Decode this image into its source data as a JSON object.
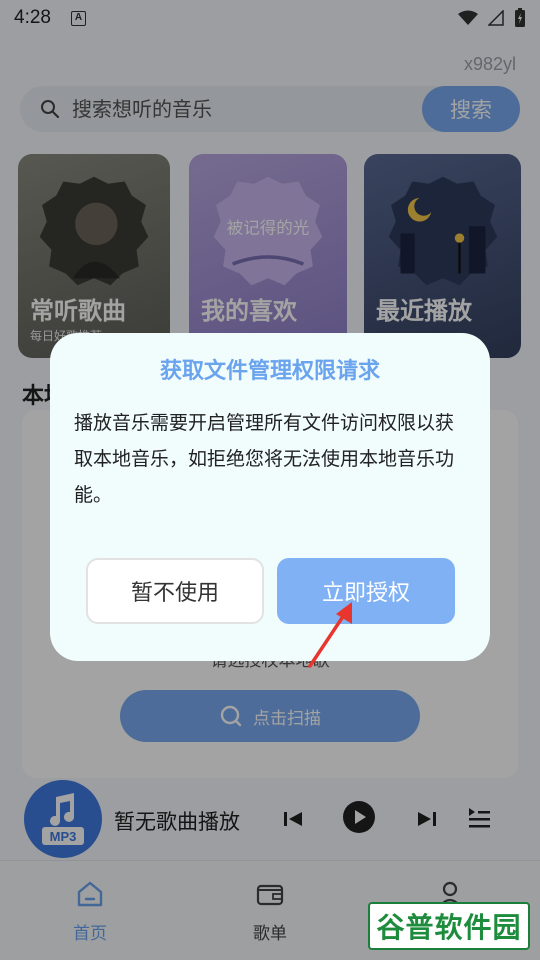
{
  "status_bar": {
    "time": "4:28",
    "a_icon": "A"
  },
  "user": {
    "id": "x982yl"
  },
  "search": {
    "placeholder": "搜索想听的音乐",
    "button_label": "搜索"
  },
  "cards": [
    {
      "title": "常听歌曲",
      "subtitle": "每日好歌推荐"
    },
    {
      "title": "我的喜欢",
      "art_text": "被记得的光"
    },
    {
      "title": "最近播放"
    }
  ],
  "local_section": {
    "title": "本地音乐",
    "tip": "请选授权本地歌",
    "scan_label": "点击扫描"
  },
  "player": {
    "now_playing": "暂无歌曲播放",
    "cover_label": "MP3"
  },
  "bottom_nav": {
    "items": [
      {
        "label": "首页",
        "active": true
      },
      {
        "label": "歌单",
        "active": false
      },
      {
        "label": "我的",
        "active": false
      }
    ]
  },
  "watermark": {
    "text": "谷普软件园"
  },
  "dialog": {
    "title": "获取文件管理权限请求",
    "body": "播放音乐需要开启管理所有文件访问权限以获取本地音乐，如拒绝您将无法使用本地音乐功能。",
    "cancel_label": "暂不使用",
    "confirm_label": "立即授权"
  },
  "colors": {
    "accent": "#7aaaf0",
    "dialog_bg": "#f1fcfc",
    "dialog_title": "#6aa3ee",
    "arrow": "#e8362e"
  }
}
